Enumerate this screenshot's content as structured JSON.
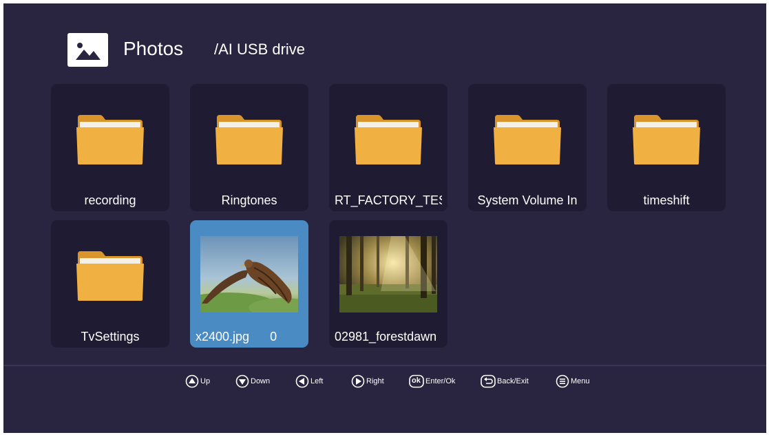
{
  "header": {
    "title": "Photos",
    "path": "/AI USB drive",
    "icon": "photo-icon"
  },
  "colors": {
    "background": "#29243f",
    "tile": "#1f1b33",
    "selected_tile": "#4a8bc3",
    "folder": "#f1b042"
  },
  "items": [
    {
      "label": "recording",
      "type": "folder",
      "icon": "folder-icon"
    },
    {
      "label": "Ringtones",
      "type": "folder",
      "icon": "folder-icon"
    },
    {
      "label": "RT_FACTORY_TEST",
      "type": "folder",
      "icon": "folder-icon"
    },
    {
      "label": "System Volume In",
      "type": "folder",
      "icon": "folder-icon"
    },
    {
      "label": "timeshift",
      "type": "folder",
      "icon": "folder-icon"
    },
    {
      "label": "TvSettings",
      "type": "folder",
      "icon": "folder-icon"
    },
    {
      "label": "x2400.jpg      0",
      "type": "image",
      "icon": "eagle-thumbnail",
      "selected": true
    },
    {
      "label": "02981_forestdawn",
      "type": "image",
      "icon": "forest-thumbnail"
    }
  ],
  "help_bar": [
    {
      "icon": "up-arrow-icon",
      "label": "Up"
    },
    {
      "icon": "down-arrow-icon",
      "label": "Down"
    },
    {
      "icon": "left-arrow-icon",
      "label": "Left"
    },
    {
      "icon": "right-arrow-icon",
      "label": "Right"
    },
    {
      "icon": "ok-icon",
      "icon_text": "ok",
      "label": "Enter/Ok"
    },
    {
      "icon": "back-icon",
      "label": "Back/Exit"
    },
    {
      "icon": "menu-icon",
      "label": "Menu"
    }
  ]
}
